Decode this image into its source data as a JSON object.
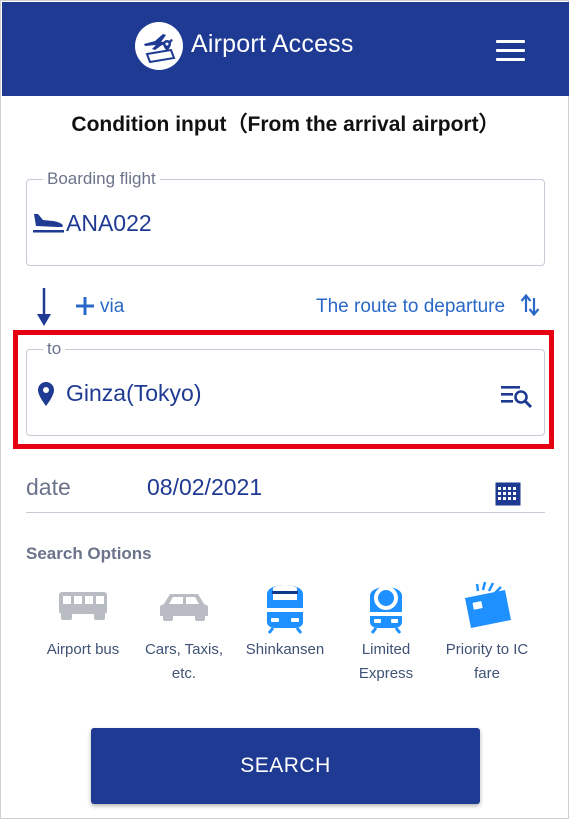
{
  "header": {
    "app_title": "Airport Access",
    "logo_icon": "airplane-pin-logo-icon",
    "menu_icon": "hamburger-menu-icon",
    "background_color": "#1f3a93"
  },
  "page_title": "Condition input（From the arrival airport）",
  "boarding_flight": {
    "label": "Boarding flight",
    "icon": "airplane-landing-icon",
    "value": "ANA022"
  },
  "route_controls": {
    "direction_icon": "arrow-down-icon",
    "add_via_label": "via",
    "add_via_icon": "plus-icon",
    "swap_label": "The route to departure",
    "swap_icon": "swap-vertical-icon"
  },
  "destination": {
    "label": "to",
    "icon": "location-pin-icon",
    "value": "Ginza(Tokyo)",
    "search_icon": "list-search-icon",
    "highlight_color": "#e60012"
  },
  "date": {
    "label": "date",
    "value": "08/02/2021",
    "icon": "calendar-icon"
  },
  "search_options": {
    "title": "Search Options",
    "items": [
      {
        "label": "Airport bus",
        "icon": "bus-icon",
        "selected": false
      },
      {
        "label": "Cars, Taxis, etc.",
        "icon": "car-icon",
        "selected": false
      },
      {
        "label": "Shinkansen",
        "icon": "shinkansen-icon",
        "selected": true
      },
      {
        "label": "Limited Express",
        "icon": "limited-express-icon",
        "selected": true
      },
      {
        "label": "Priority to IC fare",
        "icon": "ic-card-icon",
        "selected": true
      }
    ]
  },
  "search_button": {
    "label": "SEARCH"
  }
}
